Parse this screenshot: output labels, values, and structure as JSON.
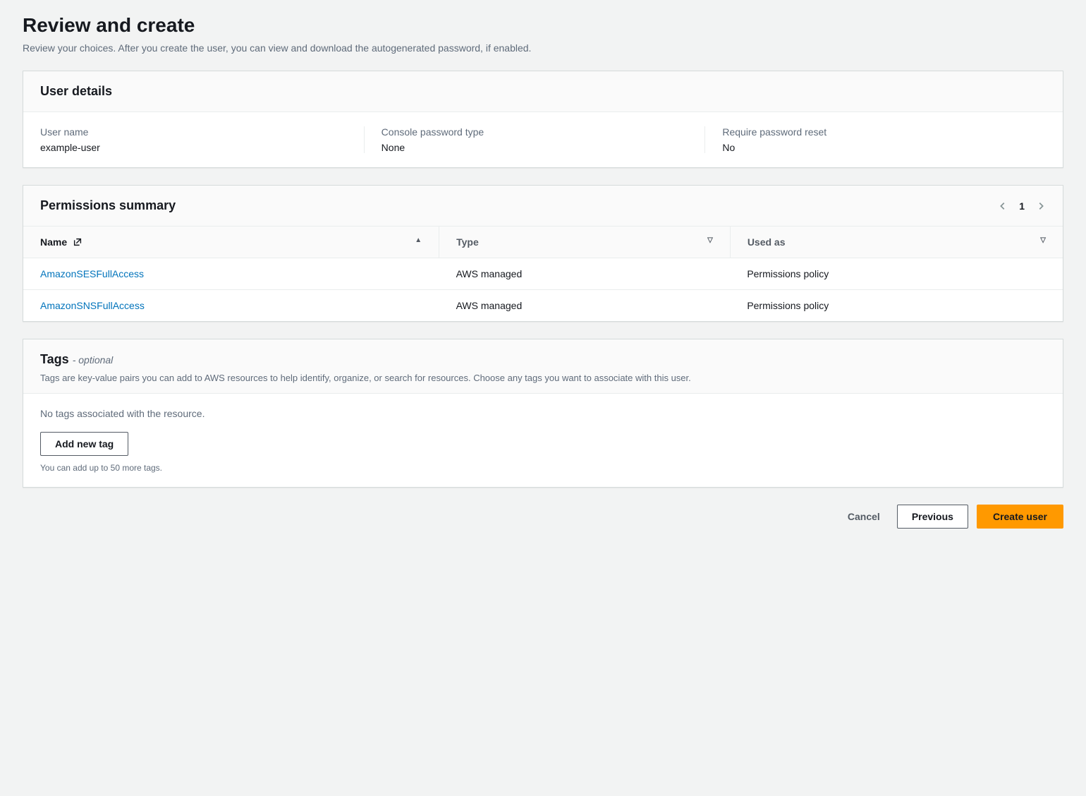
{
  "page": {
    "title": "Review and create",
    "subtitle": "Review your choices. After you create the user, you can view and download the autogenerated password, if enabled."
  },
  "user_details": {
    "header": "User details",
    "fields": [
      {
        "label": "User name",
        "value": "example-user"
      },
      {
        "label": "Console password type",
        "value": "None"
      },
      {
        "label": "Require password reset",
        "value": "No"
      }
    ]
  },
  "permissions": {
    "header": "Permissions summary",
    "page_number": "1",
    "columns": {
      "name": "Name",
      "type": "Type",
      "used_as": "Used as"
    },
    "rows": [
      {
        "name": "AmazonSESFullAccess",
        "type": "AWS managed",
        "used_as": "Permissions policy"
      },
      {
        "name": "AmazonSNSFullAccess",
        "type": "AWS managed",
        "used_as": "Permissions policy"
      }
    ]
  },
  "tags": {
    "header": "Tags",
    "optional": "- optional",
    "description": "Tags are key-value pairs you can add to AWS resources to help identify, organize, or search for resources. Choose any tags you want to associate with this user.",
    "empty": "No tags associated with the resource.",
    "add_button": "Add new tag",
    "hint": "You can add up to 50 more tags."
  },
  "footer": {
    "cancel": "Cancel",
    "previous": "Previous",
    "create": "Create user"
  }
}
